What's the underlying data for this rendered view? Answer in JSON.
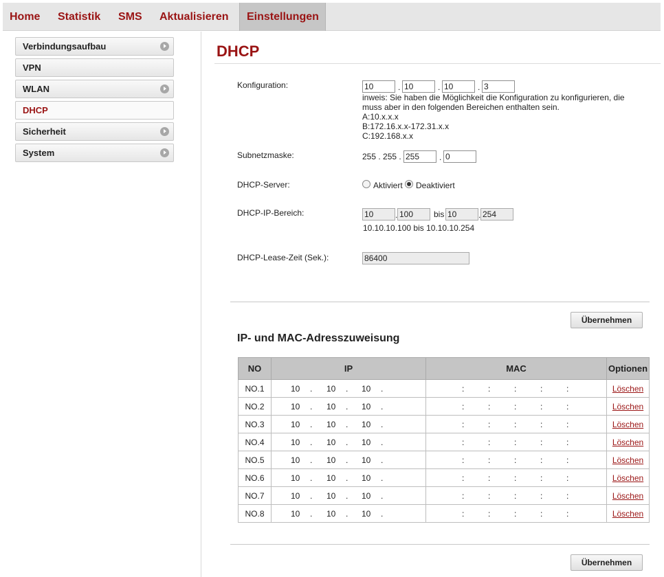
{
  "nav": {
    "tabs": [
      {
        "label": "Home"
      },
      {
        "label": "Statistik"
      },
      {
        "label": "SMS"
      },
      {
        "label": "Aktualisieren"
      },
      {
        "label": "Einstellungen",
        "active": true
      }
    ]
  },
  "sidebar": {
    "items": [
      {
        "label": "Verbindungsaufbau",
        "has_arrow": true
      },
      {
        "label": "VPN",
        "has_arrow": false
      },
      {
        "label": "WLAN",
        "has_arrow": true
      },
      {
        "label": "DHCP",
        "has_arrow": false,
        "active": true
      },
      {
        "label": "Sicherheit",
        "has_arrow": true
      },
      {
        "label": "System",
        "has_arrow": true
      }
    ]
  },
  "page": {
    "title": "DHCP",
    "config": {
      "label": "Konfiguration:",
      "octets": [
        "10",
        "10",
        "10",
        "3"
      ],
      "separator": ".",
      "hint": [
        "inweis: Sie haben die Möglichkeit die Konfiguration zu konfigurieren, die",
        "muss aber in den folgenden Bereichen enthalten sein.",
        "A:10.x.x.x",
        "B:172.16.x.x-172.31.x.x",
        "C:192.168.x.x"
      ]
    },
    "subnet": {
      "label": "Subnetzmaske:",
      "fixed_part": "255 . 255 .",
      "octet3": "255",
      "octet4": "0"
    },
    "dhcp_server": {
      "label": "DHCP-Server:",
      "option_on": "Aktiviert",
      "option_off": "Deaktiviert",
      "selected": "Deaktiviert"
    },
    "ip_range": {
      "label": "DHCP-IP-Bereich:",
      "start_a": "10",
      "start_b": "100",
      "bis": "bis",
      "end_a": "10",
      "end_b": "254",
      "summary": "10.10.10.100 bis 10.10.10.254"
    },
    "lease": {
      "label": "DHCP-Lease-Zeit (Sek.):",
      "value": "86400"
    },
    "apply_label": "Übernehmen",
    "binding": {
      "title": "IP- und MAC-Adresszuweisung",
      "headers": {
        "no": "NO",
        "ip": "IP",
        "mac": "MAC",
        "options": "Optionen"
      },
      "ip_sep": ".",
      "mac_sep": ":",
      "delete_label": "Löschen",
      "rows": [
        {
          "no": "NO.1",
          "ip": [
            "10",
            "10",
            "10"
          ]
        },
        {
          "no": "NO.2",
          "ip": [
            "10",
            "10",
            "10"
          ]
        },
        {
          "no": "NO.3",
          "ip": [
            "10",
            "10",
            "10"
          ]
        },
        {
          "no": "NO.4",
          "ip": [
            "10",
            "10",
            "10"
          ]
        },
        {
          "no": "NO.5",
          "ip": [
            "10",
            "10",
            "10"
          ]
        },
        {
          "no": "NO.6",
          "ip": [
            "10",
            "10",
            "10"
          ]
        },
        {
          "no": "NO.7",
          "ip": [
            "10",
            "10",
            "10"
          ]
        },
        {
          "no": "NO.8",
          "ip": [
            "10",
            "10",
            "10"
          ]
        }
      ]
    }
  },
  "colors": {
    "accent": "#9a1414",
    "header_bg": "#c5c5c5"
  }
}
